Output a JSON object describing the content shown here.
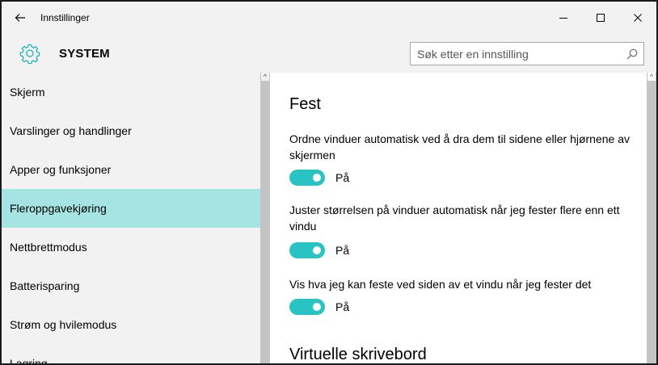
{
  "window": {
    "title": "Innstillinger"
  },
  "header": {
    "title": "SYSTEM",
    "search_placeholder": "Søk etter en innstilling"
  },
  "sidebar": {
    "items": [
      {
        "label": "Skjerm",
        "active": false
      },
      {
        "label": "Varslinger og handlinger",
        "active": false
      },
      {
        "label": "Apper og funksjoner",
        "active": false
      },
      {
        "label": "Fleroppgavekjøring",
        "active": true
      },
      {
        "label": "Nettbrettmodus",
        "active": false
      },
      {
        "label": "Batterisparing",
        "active": false
      },
      {
        "label": "Strøm og hvilemodus",
        "active": false
      },
      {
        "label": "Lagring",
        "active": false
      }
    ]
  },
  "main": {
    "section1_title": "Fest",
    "settings": [
      {
        "desc": "Ordne vinduer automatisk ved å dra dem til sidene eller hjørnene av skjermen",
        "state": "På",
        "on": true
      },
      {
        "desc": "Juster størrelsen på vinduer automatisk når jeg fester flere enn ett vindu",
        "state": "På",
        "on": true
      },
      {
        "desc": "Vis hva jeg kan feste ved siden av et vindu når jeg fester det",
        "state": "På",
        "on": true
      }
    ],
    "section2_title": "Virtuelle skrivebord"
  },
  "colors": {
    "accent": "#2ac3c3",
    "selected": "#a6e3e3",
    "chrome": "#f2f2f2"
  }
}
